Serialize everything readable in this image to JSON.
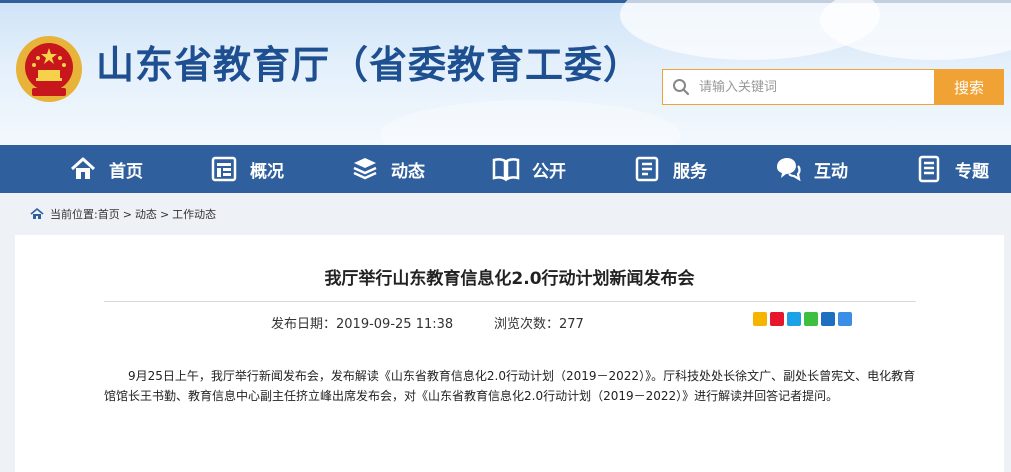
{
  "header": {
    "site_title": "山东省教育厅（省委教育工委）",
    "search_placeholder": "请输入关键词",
    "search_button": "搜索"
  },
  "nav": {
    "items": [
      {
        "label": "首页",
        "icon": "home-icon"
      },
      {
        "label": "概况",
        "icon": "overview-icon"
      },
      {
        "label": "动态",
        "icon": "news-stack-icon"
      },
      {
        "label": "公开",
        "icon": "open-book-icon"
      },
      {
        "label": "服务",
        "icon": "service-doc-icon"
      },
      {
        "label": "互动",
        "icon": "chat-bubbles-icon"
      },
      {
        "label": "专题",
        "icon": "topic-doc-icon"
      }
    ]
  },
  "breadcrumb": {
    "prefix": "当前位置:",
    "items": [
      "首页",
      "动态",
      "工作动态"
    ],
    "separator": ">"
  },
  "article": {
    "title": "我厅举行山东教育信息化2.0行动计划新闻发布会",
    "publish_label": "发布日期：",
    "publish_date": "2019-09-25 11:38",
    "views_label": "浏览次数：",
    "views": "277",
    "body": "9月25日上午，我厅举行新闻发布会，发布解读《山东省教育信息化2.0行动计划（2019－2022）》。厅科技处处长徐文广、副处长曾宪文、电化教育馆馆长王书勤、教育信息中心副主任挤立峰出席发布会，对《山东省教育信息化2.0行动计划（2019－2022）》进行解读并回答记者提问。"
  },
  "share_icons": [
    "qzone-share-icon",
    "weibo-share-icon",
    "qq-share-icon",
    "wechat-share-icon",
    "renren-share-icon",
    "more-share-icon"
  ],
  "colors": {
    "brand_blue": "#2f5f9c",
    "title_blue": "#1d4f91",
    "accent_orange": "#f0a235"
  }
}
